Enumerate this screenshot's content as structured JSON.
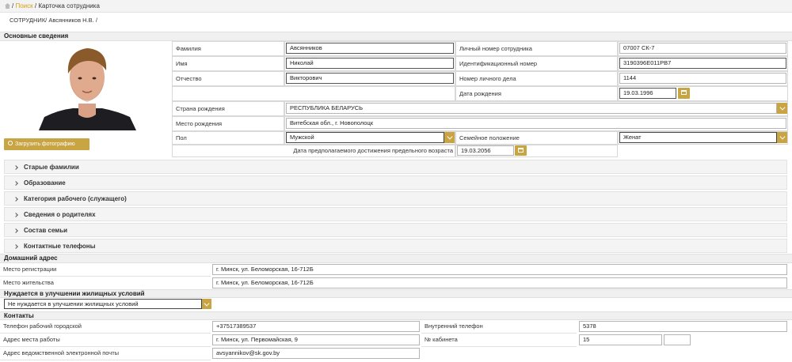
{
  "breadcrumb": {
    "link": "Поиск",
    "sep": "/",
    "current": "Карточка сотрудника"
  },
  "subtitle": "СОТРУДНИК/  Авсянников Н.В. /",
  "basic": {
    "title": "Основные сведения",
    "upload_label": "Загрузить фотографию",
    "surname_label": "Фамилия",
    "surname": "Авсянников",
    "name_label": "Имя",
    "name": "Николай",
    "patronymic_label": "Отчество",
    "patronymic": "Викторович",
    "personal_no_label": "Личный номер сотрудника",
    "personal_no": "07007 СК-7",
    "id_no_label": "Идентификационный номер",
    "id_no": "3190396E011PB7",
    "file_no_label": "Номер личного дела",
    "file_no": "1144",
    "birth_date_label": "Дата рождения",
    "birth_date": "19.03.1996",
    "birth_country_label": "Страна рождения",
    "birth_country": "РЕСПУБЛИКА БЕЛАРУСЬ",
    "birth_place_label": "Место рождения",
    "birth_place": "Витебская обл., г. Новополоцк",
    "gender_label": "Пол",
    "gender": "Мужской",
    "marital_label": "Семейное положение",
    "marital": "Женат",
    "retire_label": "Дата предполагаемого достижения предельного возраста",
    "retire_date": "19.03.2056"
  },
  "sections": [
    "Старые фамилии",
    "Образование",
    "Категория рабочего (служащего)",
    "Сведения о родителях",
    "Состав семьи",
    "Контактные телефоны"
  ],
  "address": {
    "title": "Домашний адрес",
    "reg_label": "Место регистрации",
    "reg": "г. Минск, ул. Беломорская, 16-712Б",
    "live_label": "Место жительства",
    "live": "г. Минск, ул. Беломорская, 16-712Б"
  },
  "housing": {
    "title": "Нуждается в улучшении жилищных условий",
    "value": "Не нуждается в улучшении жилищных условий"
  },
  "contacts": {
    "title": "Контакты",
    "phone_label": "Телефон рабочий городской",
    "phone": "+37517389537",
    "internal_label": "Внутренний телефон",
    "internal": "5378",
    "work_addr_label": "Адрес места работы",
    "work_addr": "г. Минск, ул. Первомайская, 9",
    "office_label": "№ кабинета",
    "office": "15",
    "email_label": "Адрес ведомственной электронной почты",
    "email": "avsyannikov@sk.gov.by"
  }
}
